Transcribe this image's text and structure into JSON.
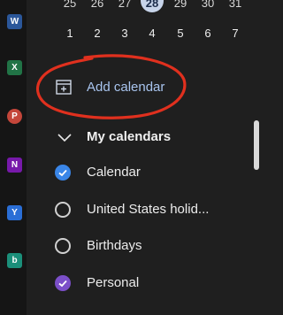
{
  "app_rail": {
    "items": [
      {
        "name": "word",
        "letter": "W",
        "color": "#2b579a"
      },
      {
        "name": "excel",
        "letter": "X",
        "color": "#217346"
      },
      {
        "name": "powerpoint",
        "letter": "P",
        "color": "#c4463a"
      },
      {
        "name": "onenote",
        "letter": "N",
        "color": "#7719aa"
      },
      {
        "name": "yammer",
        "letter": "Y",
        "color": "#2a6ed6"
      },
      {
        "name": "bookings",
        "letter": "b",
        "color": "#1b8f7a"
      }
    ]
  },
  "mini_calendar": {
    "week_top": [
      "25",
      "26",
      "27",
      "28",
      "29",
      "30",
      "31"
    ],
    "week_bottom": [
      "1",
      "2",
      "3",
      "4",
      "5",
      "6",
      "7"
    ],
    "today": "28"
  },
  "add_calendar": {
    "label": "Add calendar",
    "icon": "calendar-add-icon",
    "highlight_color": "#e0301e"
  },
  "my_calendars": {
    "label": "My calendars",
    "items": [
      {
        "label": "Calendar",
        "checked": true,
        "color": "#3a86e8"
      },
      {
        "label": "United States holid...",
        "checked": false,
        "color": ""
      },
      {
        "label": "Birthdays",
        "checked": false,
        "color": ""
      },
      {
        "label": "Personal",
        "checked": true,
        "color": "#7b4fc9"
      }
    ]
  },
  "colors": {
    "background": "#1f1f1f",
    "accent": "#a8c4ee"
  }
}
